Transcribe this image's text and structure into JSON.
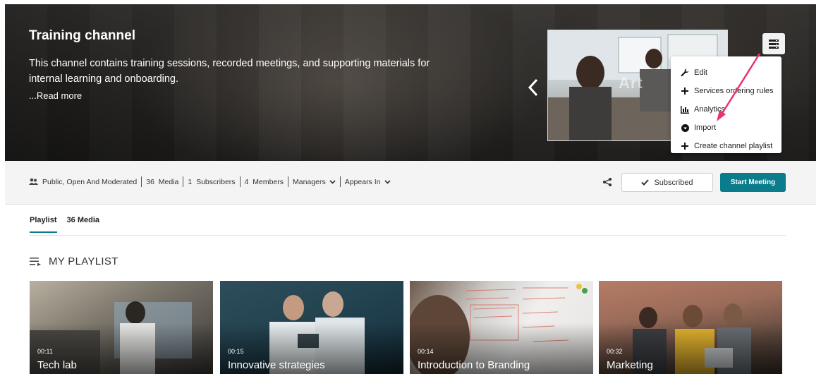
{
  "channel": {
    "title": "Training channel",
    "description": "This channel contains training sessions, recorded meetings, and supporting materials for internal learning and onboarding.",
    "read_more": "...Read more",
    "thumbnail_watermark": "Art"
  },
  "actions_menu": {
    "items": [
      {
        "label": "Edit",
        "icon": "wrench-icon"
      },
      {
        "label": "Services ordering rules",
        "icon": "plus-icon"
      },
      {
        "label": "Analytics",
        "icon": "bar-chart-icon"
      },
      {
        "label": "Import",
        "icon": "import-icon"
      },
      {
        "label": "Create channel playlist",
        "icon": "plus-icon"
      }
    ]
  },
  "meta": {
    "privacy": "Public, Open And Moderated",
    "media_count": "36",
    "media_label": "Media",
    "subscribers_count": "1",
    "subscribers_label": "Subscribers",
    "members_count": "4",
    "members_label": "Members",
    "managers_label": "Managers",
    "appears_in_label": "Appears In"
  },
  "buttons": {
    "subscribed": "Subscribed",
    "start_meeting": "Start Meeting"
  },
  "tabs": [
    {
      "label": "Playlist",
      "active": true
    },
    {
      "label": "36 Media",
      "active": false
    }
  ],
  "playlist": {
    "heading": "MY PLAYLIST",
    "items": [
      {
        "duration": "00:11",
        "title": "Tech lab"
      },
      {
        "duration": "00:15",
        "title": "Innovative strategies"
      },
      {
        "duration": "00:14",
        "title": "Introduction to Branding"
      },
      {
        "duration": "00:32",
        "title": "Marketing"
      }
    ]
  },
  "colors": {
    "accent": "#0a7c8c",
    "annotation_arrow": "#e8336f"
  }
}
